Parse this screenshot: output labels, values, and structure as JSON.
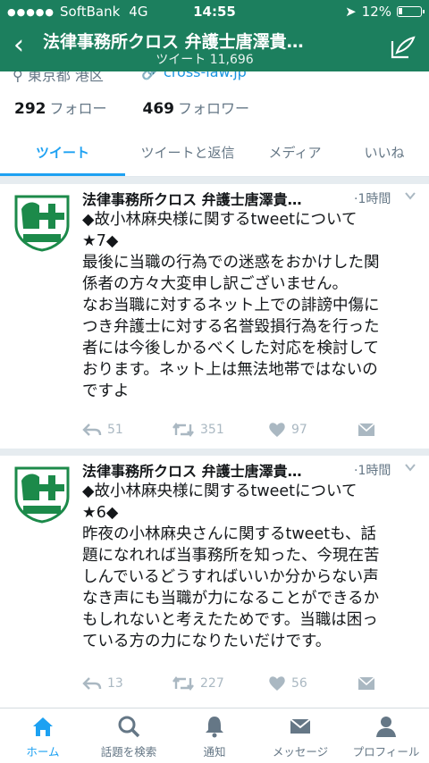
{
  "status_bar": {
    "signal": "●●●●●",
    "carrier": "SoftBank",
    "network": "4G",
    "time": "14:55",
    "battery": "12%"
  },
  "nav": {
    "back_label": "‹",
    "title": "法律事務所クロス 弁護士唐澤貴…",
    "subtitle": "ツイート 11,696"
  },
  "profile": {
    "location": "東京都 港区",
    "link": "cross-law.jp",
    "following_count": "292",
    "following_label": "フォロー",
    "followers_count": "469",
    "followers_label": "フォロワー"
  },
  "tabs": [
    "ツイート",
    "ツイートと返信",
    "メディア",
    "いいね"
  ],
  "tweets": [
    {
      "name": "法律事務所クロス 弁護士唐澤貴…",
      "time": "·1時間",
      "lines": [
        "◆故小林麻央様に関するtweetについて",
        "★7◆",
        "最後に当職の行為での迷惑をおかけした関",
        "係者の方々大変申し訳ございません。",
        "なお当職に対するネット上での誹謗中傷に",
        "つき弁護士に対する名誉毀損行為を行った",
        "者には今後しかるべくした対応を検討して",
        "おります。ネット上は無法地帯ではないの",
        "ですよ"
      ],
      "replies": "51",
      "retweets": "351",
      "likes": "97"
    },
    {
      "name": "法律事務所クロス 弁護士唐澤貴…",
      "time": "·1時間",
      "lines": [
        "◆故小林麻央様に関するtweetについて",
        "★6◆",
        "昨夜の小林麻央さんに関するtweetも、話",
        "題になれれば当事務所を知った、今現在苦",
        "しんでいるどうすればいいか分からない声",
        "なき声にも当職が力になることができるか",
        "もしれないと考えたためです。当職は困っ",
        "ている方の力になりたいだけです。"
      ],
      "replies": "13",
      "retweets": "227",
      "likes": "56"
    }
  ],
  "tabbar": [
    "ホーム",
    "話題を検索",
    "通知",
    "メッセージ",
    "プロフィール"
  ],
  "colors": {
    "header": "#1c7f5e",
    "accent": "#1da1f2",
    "muted": "#657786",
    "action": "#aab8c2"
  }
}
